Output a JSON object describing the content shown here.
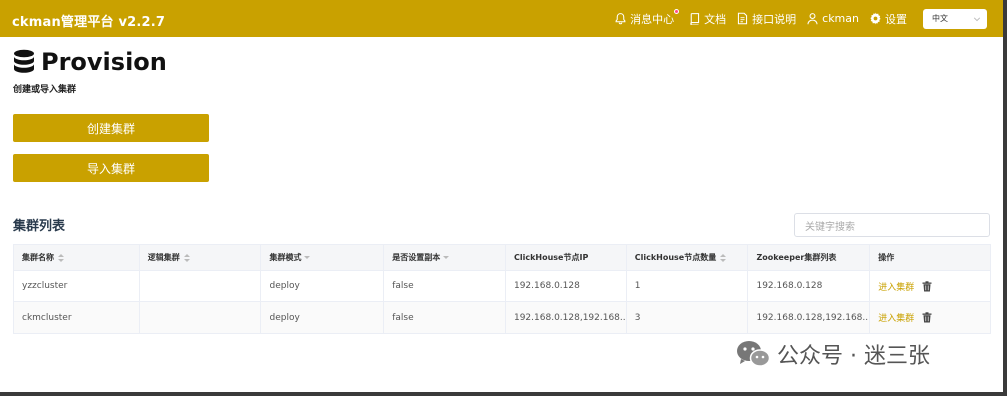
{
  "app": {
    "title": "ckman管理平台 v2.2.7"
  },
  "nav": {
    "messages": "消息中心",
    "docs": "文档",
    "api": "接口说明",
    "user": "ckman",
    "settings": "设置",
    "language": "中文"
  },
  "page": {
    "title": "Provision",
    "subtitle": "创建或导入集群",
    "create_button": "创建集群",
    "import_button": "导入集群",
    "list_title": "集群列表",
    "search_placeholder": "关键字搜索"
  },
  "table": {
    "columns": [
      "集群名称",
      "逻辑集群",
      "集群模式",
      "是否设置副本",
      "ClickHouse节点IP",
      "ClickHouse节点数量",
      "Zookeeper集群列表",
      "操作"
    ],
    "rows": [
      {
        "name": "yzzcluster",
        "logic": "",
        "mode": "deploy",
        "replica": "false",
        "ip": "192.168.0.128",
        "count": "1",
        "zk": "192.168.0.128",
        "action": "进入集群"
      },
      {
        "name": "ckmcluster",
        "logic": "",
        "mode": "deploy",
        "replica": "false",
        "ip": "192.168.0.128,192.168....",
        "count": "3",
        "zk": "192.168.0.128,192.168....",
        "action": "进入集群"
      }
    ]
  },
  "watermark": "公众号 · 迷三张",
  "colors": {
    "brand": "#c9a100"
  }
}
